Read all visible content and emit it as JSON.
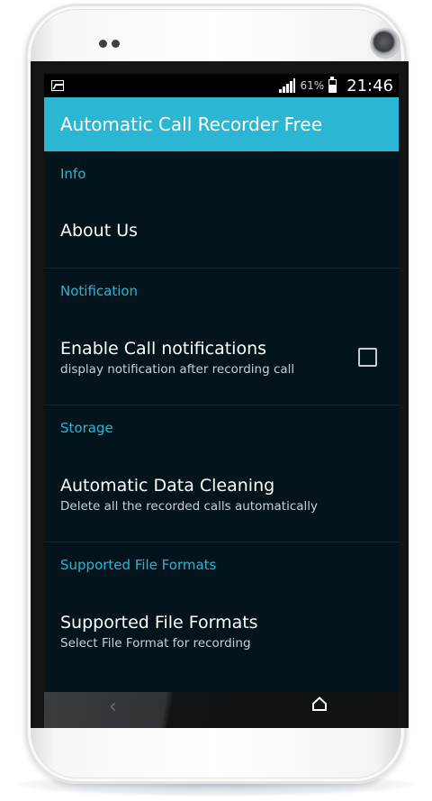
{
  "status_bar": {
    "battery": "61%",
    "time": "21:46"
  },
  "app_bar": {
    "title": "Automatic Call Recorder Free",
    "color": "#2bb6d3"
  },
  "accent_color": "#2bb6d3",
  "sections": [
    {
      "header": "Info",
      "items": [
        {
          "title": "About Us"
        }
      ]
    },
    {
      "header": "Notification",
      "items": [
        {
          "title": "Enable Call notifications",
          "summary": "display notification after recording call",
          "checked": false
        }
      ]
    },
    {
      "header": "Storage",
      "items": [
        {
          "title": "Automatic Data Cleaning",
          "summary": "Delete all the recorded calls automatically"
        }
      ]
    },
    {
      "header": "Supported File Formats",
      "items": [
        {
          "title": "Supported File Formats",
          "summary": "Select File Format for recording"
        }
      ]
    }
  ],
  "nav_bar": {
    "back_icon": "chevron-left-icon",
    "home_icon": "home-icon"
  }
}
